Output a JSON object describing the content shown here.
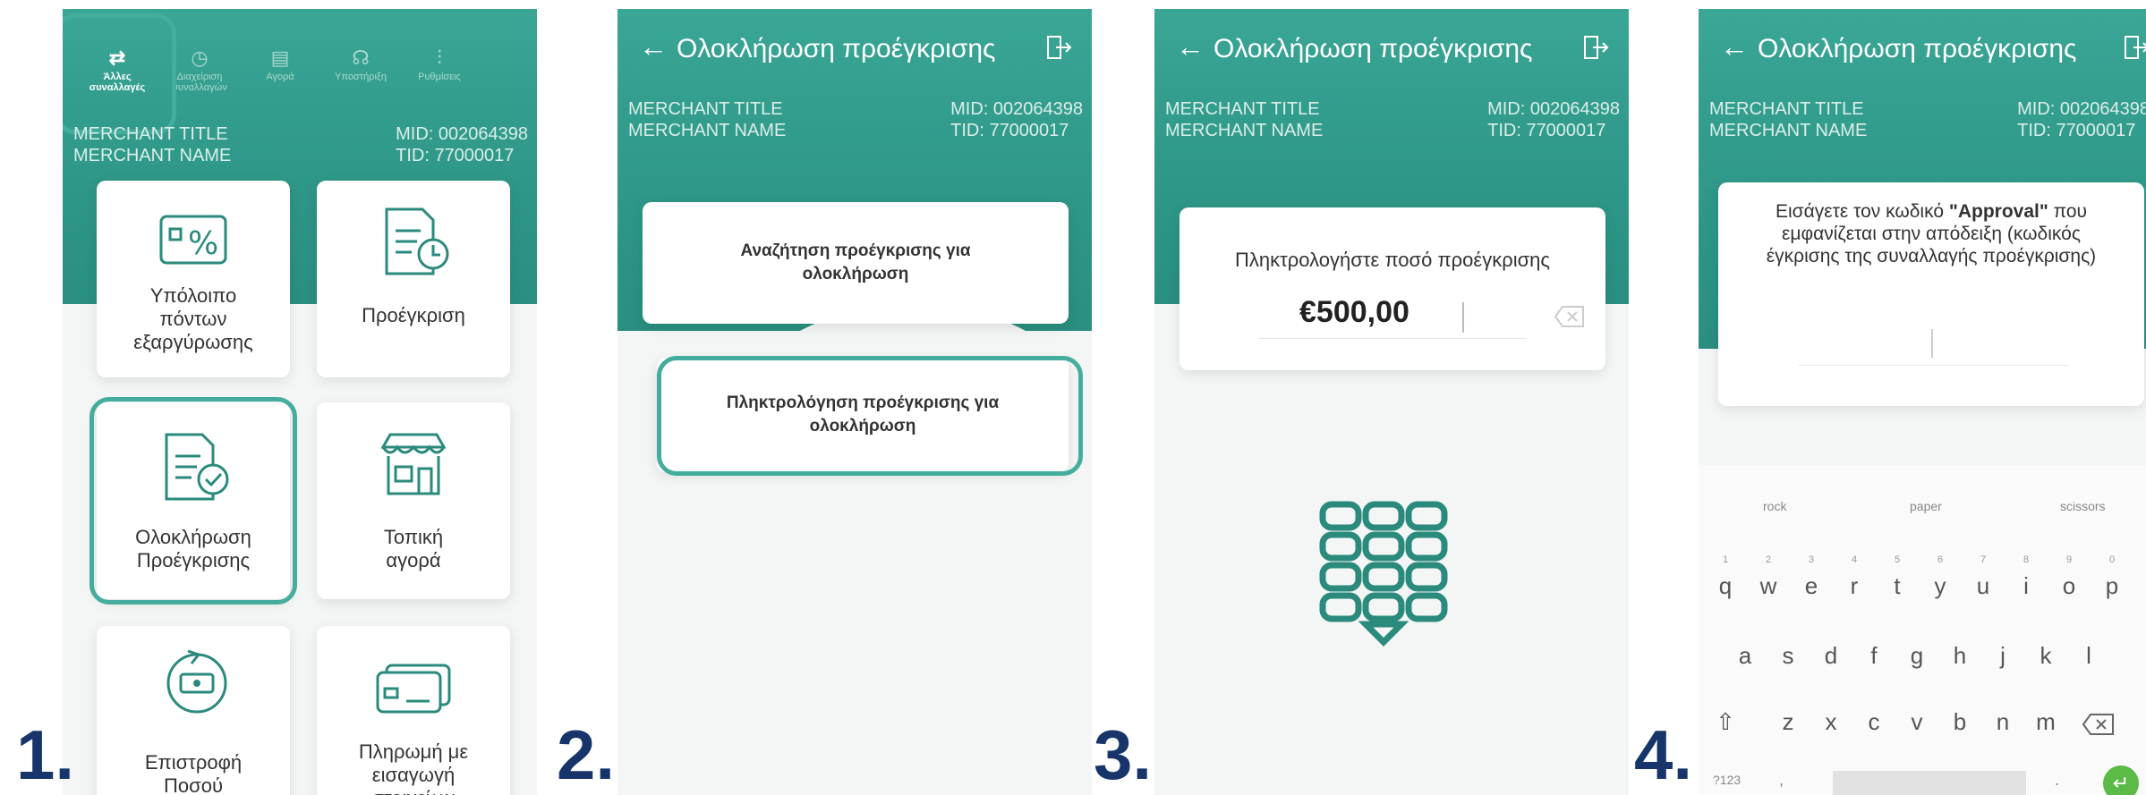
{
  "steps": [
    "1.",
    "2.",
    "3.",
    "4."
  ],
  "screen1": {
    "tabs": [
      {
        "label": "Άλλες συναλλαγές",
        "icon": "arrows-icon"
      },
      {
        "label": "Διαχείριση συναλλαγών",
        "icon": "clock-icon"
      },
      {
        "label": "Αγορά",
        "icon": "receipt-icon"
      },
      {
        "label": "Υποστήριξη",
        "icon": "support-icon"
      },
      {
        "label": "Ρυθμίσεις",
        "icon": "settings-icon"
      }
    ],
    "merchant_title": "MERCHANT TITLE",
    "merchant_name": "MERCHANT NAME",
    "mid": "MID: 002064398",
    "tid": "TID: 77000017",
    "tiles": [
      {
        "label": "Υπόλοιπο πόντων εξαργύρωσης",
        "icon": "percent-icon"
      },
      {
        "label": "Προέγκριση",
        "icon": "document-clock-icon"
      },
      {
        "label": "Ολοκλήρωση Προέγκρισης",
        "icon": "document-check-icon"
      },
      {
        "label": "Τοπική αγορά",
        "icon": "shop-icon"
      },
      {
        "label": "Επιστροφή Ποσού",
        "icon": "refund-icon"
      },
      {
        "label": "Πληρωμή με εισαγωγή στοιχείων κάρτας",
        "icon": "card-icon"
      }
    ]
  },
  "screen2": {
    "title": "Ολοκλήρωση προέγκρισης",
    "merchant_title": "MERCHANT TITLE",
    "merchant_name": "MERCHANT NAME",
    "mid": "MID: 002064398",
    "tid": "TID: 77000017",
    "option_search": "Αναζήτηση προέγκρισης για ολοκλήρωση",
    "option_type": "Πληκτρολόγηση προέγκρισης για ολοκλήρωση"
  },
  "screen3": {
    "title": "Ολοκλήρωση προέγκρισης",
    "merchant_title": "MERCHANT TITLE",
    "merchant_name": "MERCHANT NAME",
    "mid": "MID: 002064398",
    "tid": "TID: 77000017",
    "prompt": "Πληκτρολογήστε ποσό προέγκρισης",
    "amount": "€500,00"
  },
  "screen4": {
    "title": "Ολοκλήρωση προέγκρισης",
    "merchant_title": "MERCHANT TITLE",
    "merchant_name": "MERCHANT NAME",
    "mid": "MID: 002064398",
    "tid": "TID: 77000017",
    "prompt_before": "Εισάγετε τον κωδικό ",
    "prompt_bold": "\"Approval\"",
    "prompt_after": " που εμφανίζεται στην απόδειξη (κωδικός έγκρισης της συναλλαγής προέγκρισης)",
    "suggestions": [
      "rock",
      "paper",
      "scissors"
    ],
    "row1": [
      "q",
      "w",
      "e",
      "r",
      "t",
      "y",
      "u",
      "i",
      "o",
      "p"
    ],
    "row1_nums": [
      "1",
      "2",
      "3",
      "4",
      "5",
      "6",
      "7",
      "8",
      "9",
      "0"
    ],
    "row2": [
      "a",
      "s",
      "d",
      "f",
      "g",
      "h",
      "j",
      "k",
      "l"
    ],
    "row3": [
      "z",
      "x",
      "c",
      "v",
      "b",
      "n",
      "m"
    ],
    "sym_key": "?123",
    "comma_key": ",",
    "period_key": "."
  },
  "colors": {
    "header": "#2f9888",
    "highlight": "#44ad9d",
    "step": "#17356a",
    "icon": "#2a8a7c"
  }
}
